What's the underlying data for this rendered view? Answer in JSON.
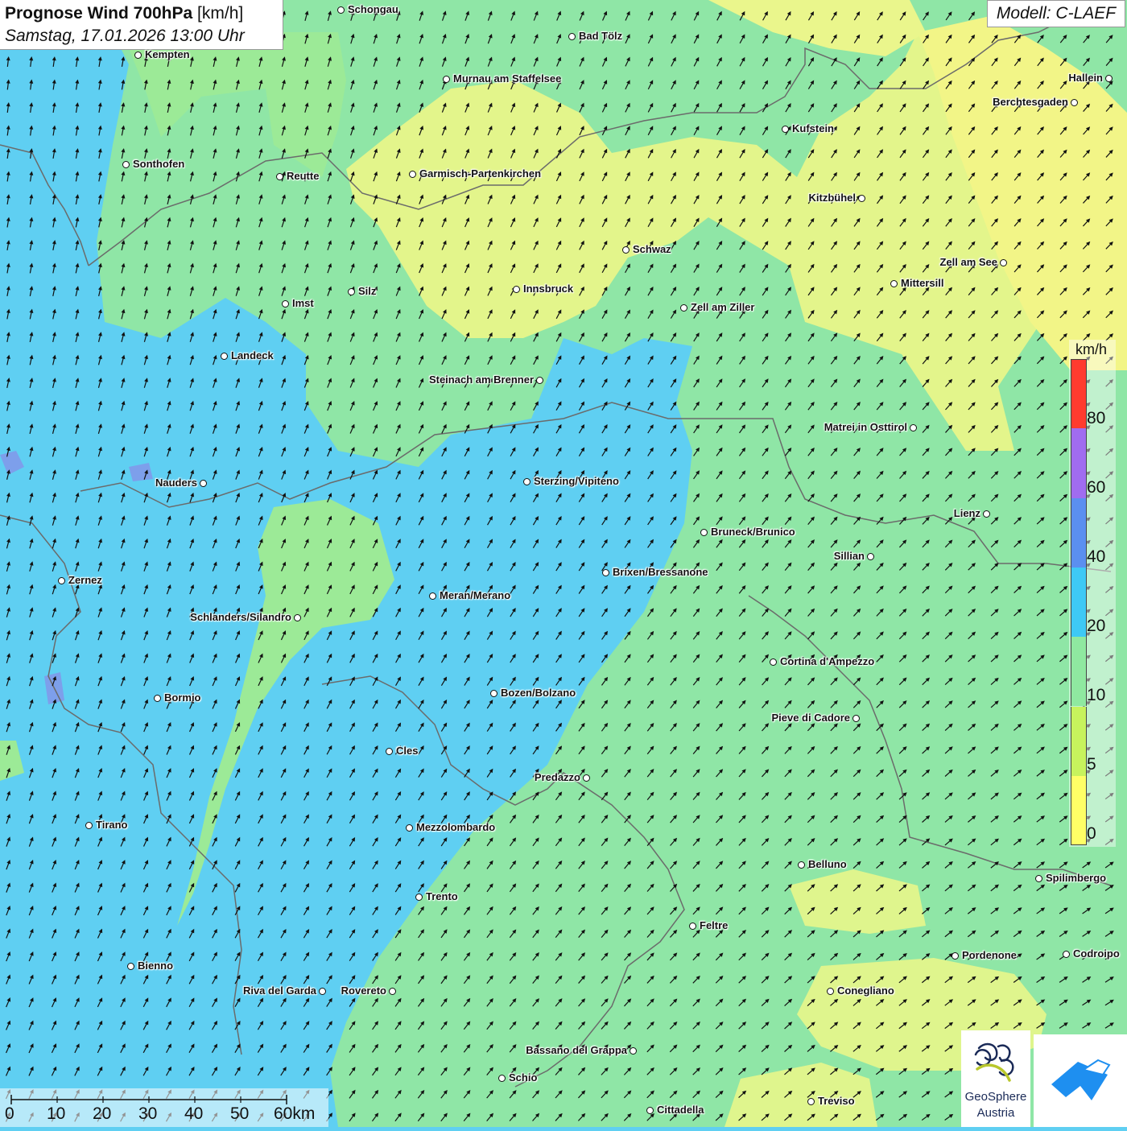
{
  "header": {
    "title_bold": "Prognose Wind 700hPa",
    "title_unit": "[km/h]",
    "subtitle": "Samstag, 17.01.2026 13:00 Uhr",
    "model": "Modell: C-LAEF"
  },
  "legend": {
    "unit": "km/h",
    "ticks": [
      "80",
      "60",
      "40",
      "20",
      "10",
      "5",
      "0"
    ],
    "colors": [
      "#ff3b2f",
      "#a06cf0",
      "#5b8ff0",
      "#3ec9f5",
      "#8fe9a0",
      "#c7f35d",
      "#ffff66"
    ]
  },
  "scale": {
    "labels": [
      "0",
      "10",
      "20",
      "30",
      "40",
      "50",
      "60km"
    ]
  },
  "branding": {
    "geo_line1": "GeoSphere",
    "geo_line2": "Austria"
  },
  "colors": {
    "calm_yellow": "#f2f587",
    "light_green": "#9cea97",
    "green": "#8fe6a6",
    "blue": "#5fcff2",
    "border": "#6b6b6b"
  },
  "cities": [
    {
      "name": "Schongau"
    },
    {
      "name": "Kempten"
    },
    {
      "name": "Bad Tölz"
    },
    {
      "name": "Murnau am Staffelsee"
    },
    {
      "name": "Hallein"
    },
    {
      "name": "Berchtesgaden"
    },
    {
      "name": "Kufstein"
    },
    {
      "name": "Sonthofen"
    },
    {
      "name": "Reutte"
    },
    {
      "name": "Garmisch-Partenkirchen"
    },
    {
      "name": "Kitzbühel"
    },
    {
      "name": "Schwaz"
    },
    {
      "name": "Zell am See"
    },
    {
      "name": "Silz"
    },
    {
      "name": "Innsbruck"
    },
    {
      "name": "Mittersill"
    },
    {
      "name": "Imst"
    },
    {
      "name": "Zell am Ziller"
    },
    {
      "name": "Landeck"
    },
    {
      "name": "Steinach am Brenner"
    },
    {
      "name": "Matrei in Osttirol"
    },
    {
      "name": "Nauders"
    },
    {
      "name": "Sterzing/Vipiteno"
    },
    {
      "name": "Lienz"
    },
    {
      "name": "Bruneck/Brunico"
    },
    {
      "name": "Sillian"
    },
    {
      "name": "Brixen/Bressanone"
    },
    {
      "name": "Zernez"
    },
    {
      "name": "Meran/Merano"
    },
    {
      "name": "Schlanders/Silandro"
    },
    {
      "name": "Cortina d'Ampezzo"
    },
    {
      "name": "Bormio"
    },
    {
      "name": "Bozen/Bolzano"
    },
    {
      "name": "Pieve di Cadore"
    },
    {
      "name": "Cles"
    },
    {
      "name": "Predazzo"
    },
    {
      "name": "Tirano"
    },
    {
      "name": "Mezzolombardo"
    },
    {
      "name": "Belluno"
    },
    {
      "name": "Spilimbergo"
    },
    {
      "name": "Trento"
    },
    {
      "name": "Feltre"
    },
    {
      "name": "Pordenone"
    },
    {
      "name": "Codroipo"
    },
    {
      "name": "Bienno"
    },
    {
      "name": "Riva del Garda"
    },
    {
      "name": "Rovereto"
    },
    {
      "name": "Conegliano"
    },
    {
      "name": "Bassano del Grappa"
    },
    {
      "name": "Schio"
    },
    {
      "name": "Treviso"
    },
    {
      "name": "Cittadella"
    }
  ]
}
